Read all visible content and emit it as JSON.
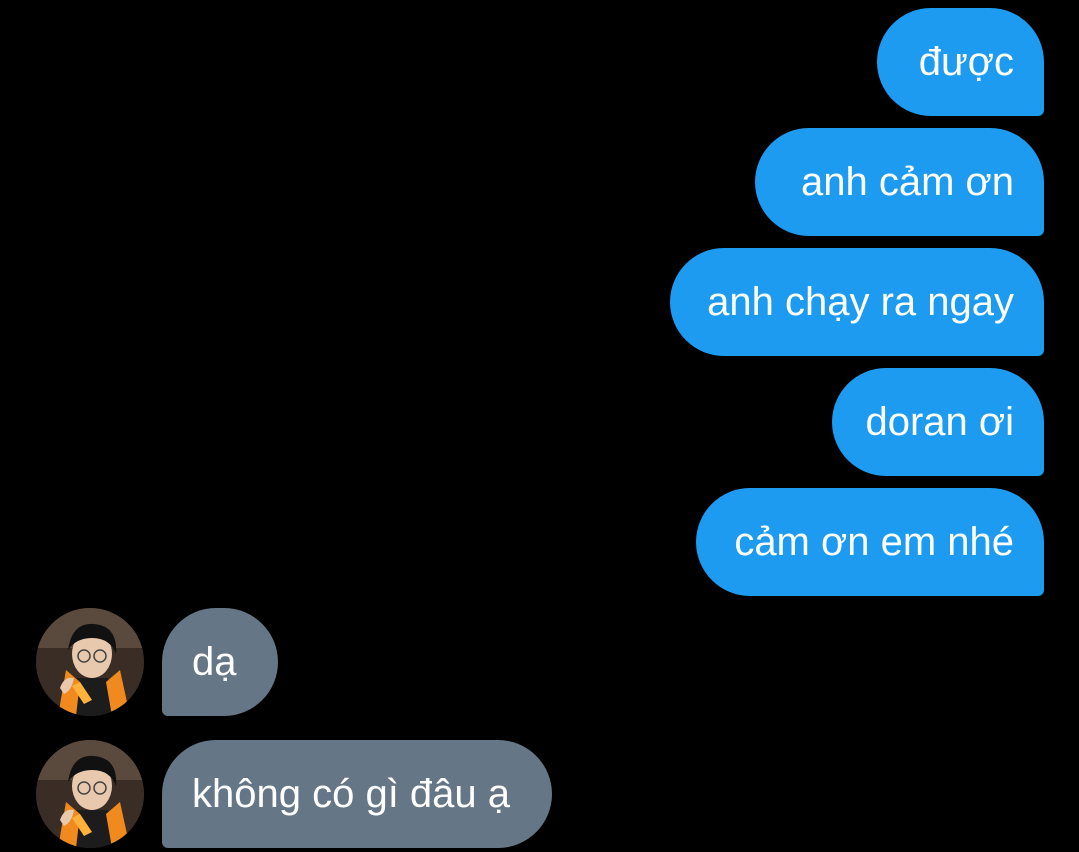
{
  "thread": {
    "sent_messages": [
      {
        "text": "được"
      },
      {
        "text": "anh cảm ơn"
      },
      {
        "text": "anh chạy ra ngay"
      },
      {
        "text": "doran ơi"
      },
      {
        "text": "cảm ơn em nhé"
      }
    ],
    "received_messages": [
      {
        "text": "dạ",
        "avatar": "contact-avatar-photo"
      },
      {
        "text": "không có gì đâu ạ",
        "avatar": "contact-avatar-photo"
      }
    ]
  },
  "colors": {
    "background": "#000000",
    "sent_bubble": "#1d9bf0",
    "received_bubble": "#657786",
    "text": "#ffffff"
  }
}
